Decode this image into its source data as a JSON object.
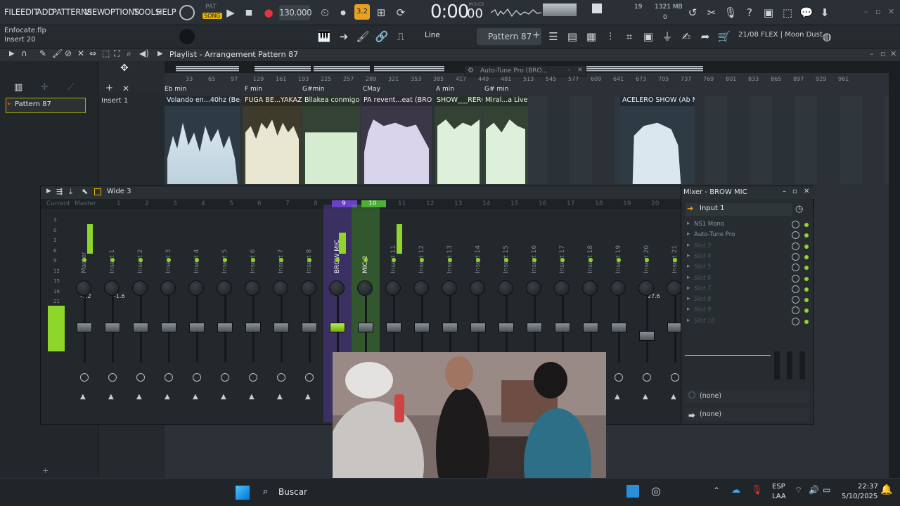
{
  "menu": [
    "FILE",
    "EDIT",
    "ADD",
    "PATTERNS",
    "VIEW",
    "OPTIONS",
    "TOOLS",
    "HELP"
  ],
  "transport": {
    "pat_song_top": "PAT",
    "pat_song": "SONG",
    "tempo": "130.000",
    "time": "0:00",
    "time_sub": "00",
    "time_unit": "M:S:CS",
    "step": "3.2"
  },
  "cpu": {
    "poly": "19",
    "mem": "1321 MB",
    "poly2": "0"
  },
  "project": {
    "file": "Enfocate.flp",
    "insert": "Insert 20"
  },
  "tool_mode": {
    "snap": "Line",
    "pattern": "Pattern 87",
    "plugin_hint": "21/08  FLEX | Moon Dust"
  },
  "playlist": {
    "title": "Playlist - Arrangement",
    "pattern": "Pattern 87",
    "floating": "Auto-Tune Pro (BRO...",
    "pattern_item": "Pattern 87",
    "track": "Insert 1",
    "ruler": [
      "33",
      "65",
      "97",
      "129",
      "161",
      "193",
      "225",
      "257",
      "289",
      "321",
      "353",
      "385",
      "417",
      "449",
      "481",
      "513",
      "545",
      "577",
      "609",
      "641",
      "673",
      "705",
      "737",
      "769",
      "801",
      "833",
      "865",
      "897",
      "929",
      "961"
    ],
    "keys": [
      "Eb min",
      "F min",
      "G#min",
      "CMay",
      "A min",
      "G# min"
    ],
    "clips": [
      "Volando en...40hz (Beat)",
      "FUGA BE...YAKAZZ",
      "Bllakea conmigo",
      "PA revent...eat (BROW)",
      "SHOW___RERO",
      "Miral...a Live",
      "ACELERO SHOW (Ab Min)"
    ]
  },
  "mixer": {
    "toolbar_label": "Wide 3",
    "header_current": "Current",
    "header_master": "Master",
    "numbers": [
      "1",
      "2",
      "3",
      "4",
      "5",
      "6",
      "7",
      "8",
      "9",
      "10",
      "11",
      "12",
      "13",
      "14",
      "15",
      "16",
      "17",
      "18",
      "19",
      "20"
    ],
    "db_scale": [
      "3",
      "0",
      "3",
      "6",
      "9",
      "12",
      "15",
      "18",
      "21"
    ],
    "master_db": "-1.2",
    "insert1_db": "-1.6",
    "insert20_db": "-27.6",
    "strips": [
      "Master",
      "Insert 1",
      "Insert 2",
      "Insert 3",
      "Insert 4",
      "Insert 5",
      "Insert 6",
      "Insert 7",
      "Insert 8",
      "BROW MIC",
      "MIC 2",
      "Insert 11",
      "Insert 12",
      "Insert 13",
      "Insert 14",
      "Insert 15",
      "Insert 16",
      "Insert 17",
      "Insert 18",
      "Insert 19",
      "Insert 20",
      "Insert 21"
    ],
    "selected_color": "#6a3fc9",
    "mic2_color": "#4fae35"
  },
  "fx_panel": {
    "title": "Mixer - BROW MIC",
    "input": "Input 1",
    "slots": [
      "NS1 Mono",
      "Auto-Tune Pro",
      "Slot 3",
      "Slot 4",
      "Slot 5",
      "Slot 6",
      "Slot 7",
      "Slot 8",
      "Slot 9",
      "Slot 10"
    ],
    "send1": "(none)",
    "send2": "(none)"
  },
  "taskbar": {
    "search": "Buscar",
    "lang1": "ESP",
    "lang2": "LAA",
    "time": "22:37",
    "date": "5/10/2025"
  },
  "colors": {
    "accent_green": "#8ed62a",
    "record": "#e0363b",
    "song_badge": "#e8b200"
  }
}
